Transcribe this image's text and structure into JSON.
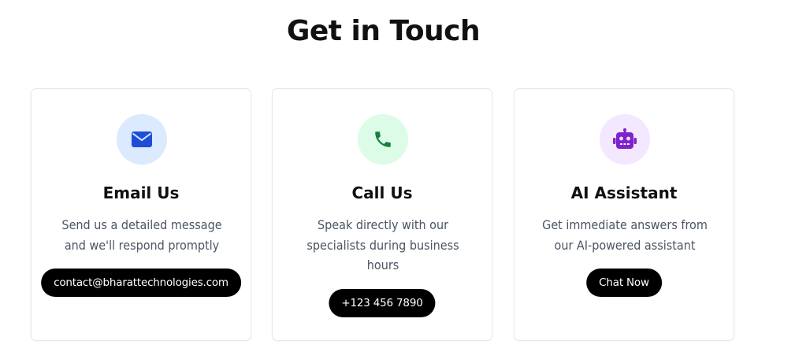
{
  "section": {
    "title": "Get in Touch"
  },
  "cards": [
    {
      "title": "Email Us",
      "desc_line1": "Send us a detailed message",
      "desc_line2": "and we'll respond promptly",
      "action": "contact@bharattechnologies.com",
      "icon": "envelope-icon",
      "icon_bg": "#dbeafe",
      "icon_color": "#1d4ed8"
    },
    {
      "title": "Call Us",
      "desc_line1": "Speak directly with our",
      "desc_line2": "specialists during business",
      "desc_line3": "hours",
      "action": "+123 456 7890",
      "icon": "phone-icon",
      "icon_bg": "#dcfce7",
      "icon_color": "#15803d"
    },
    {
      "title": "AI Assistant",
      "desc_line1": "Get immediate answers from",
      "desc_line2": "our AI-powered assistant",
      "action": "Chat Now",
      "icon": "robot-icon",
      "icon_bg": "#f3e8ff",
      "icon_color": "#7e22ce"
    }
  ]
}
